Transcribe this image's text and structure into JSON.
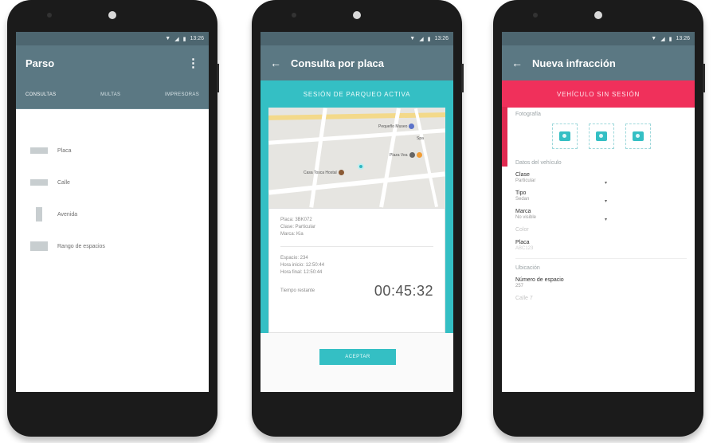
{
  "screen1": {
    "status": "13:26",
    "title": "Parso",
    "tabs": [
      "CONSULTAS",
      "MULTAS",
      "IMPRESORAS"
    ],
    "items": [
      "Placa",
      "Calle",
      "Avenida",
      "Rango de espacios"
    ]
  },
  "screen2": {
    "status": "13:26",
    "title": "Consulta por placa",
    "banner": "SESIÓN DE PARQUEO ACTIVA",
    "map_labels": {
      "poi1": "Pequeño Museo",
      "poi2": "Plaza Vea",
      "poi3": "Casa Tosca Hostal",
      "poi4": "Spa"
    },
    "card": {
      "placa": "Placa: 3BK072",
      "clase": "Clase: Particular",
      "marca": "Marca: Kia",
      "espacio": "Espacio: 234",
      "hora_inicio": "Hora inicio: 12:50:44",
      "hora_final": "Hora final: 12:50:44",
      "remaining_label": "Tiempo restante",
      "timer": "00:45:32"
    },
    "button": "ACEPTAR"
  },
  "screen3": {
    "status": "13:26",
    "title": "Nueva infracción",
    "banner": "VEHÍCULO SIN SESIÓN",
    "photo_section": "Fotografía",
    "vehicle_section": "Datos del vehículo",
    "fields": [
      {
        "label": "Clase",
        "value": "Particular"
      },
      {
        "label": "Tipo",
        "value": "Sedan"
      },
      {
        "label": "Marca",
        "value": "No visible"
      }
    ],
    "color_label": "Color",
    "plate_label": "Placa",
    "plate_value": "ABC123",
    "location_section": "Ubicación",
    "space_label": "Número de espacio",
    "space_value": "257",
    "street_label": "Calle 7"
  },
  "colors": {
    "appbar": "#5b7883",
    "teal": "#34bfc4",
    "red": "#f0305b"
  }
}
